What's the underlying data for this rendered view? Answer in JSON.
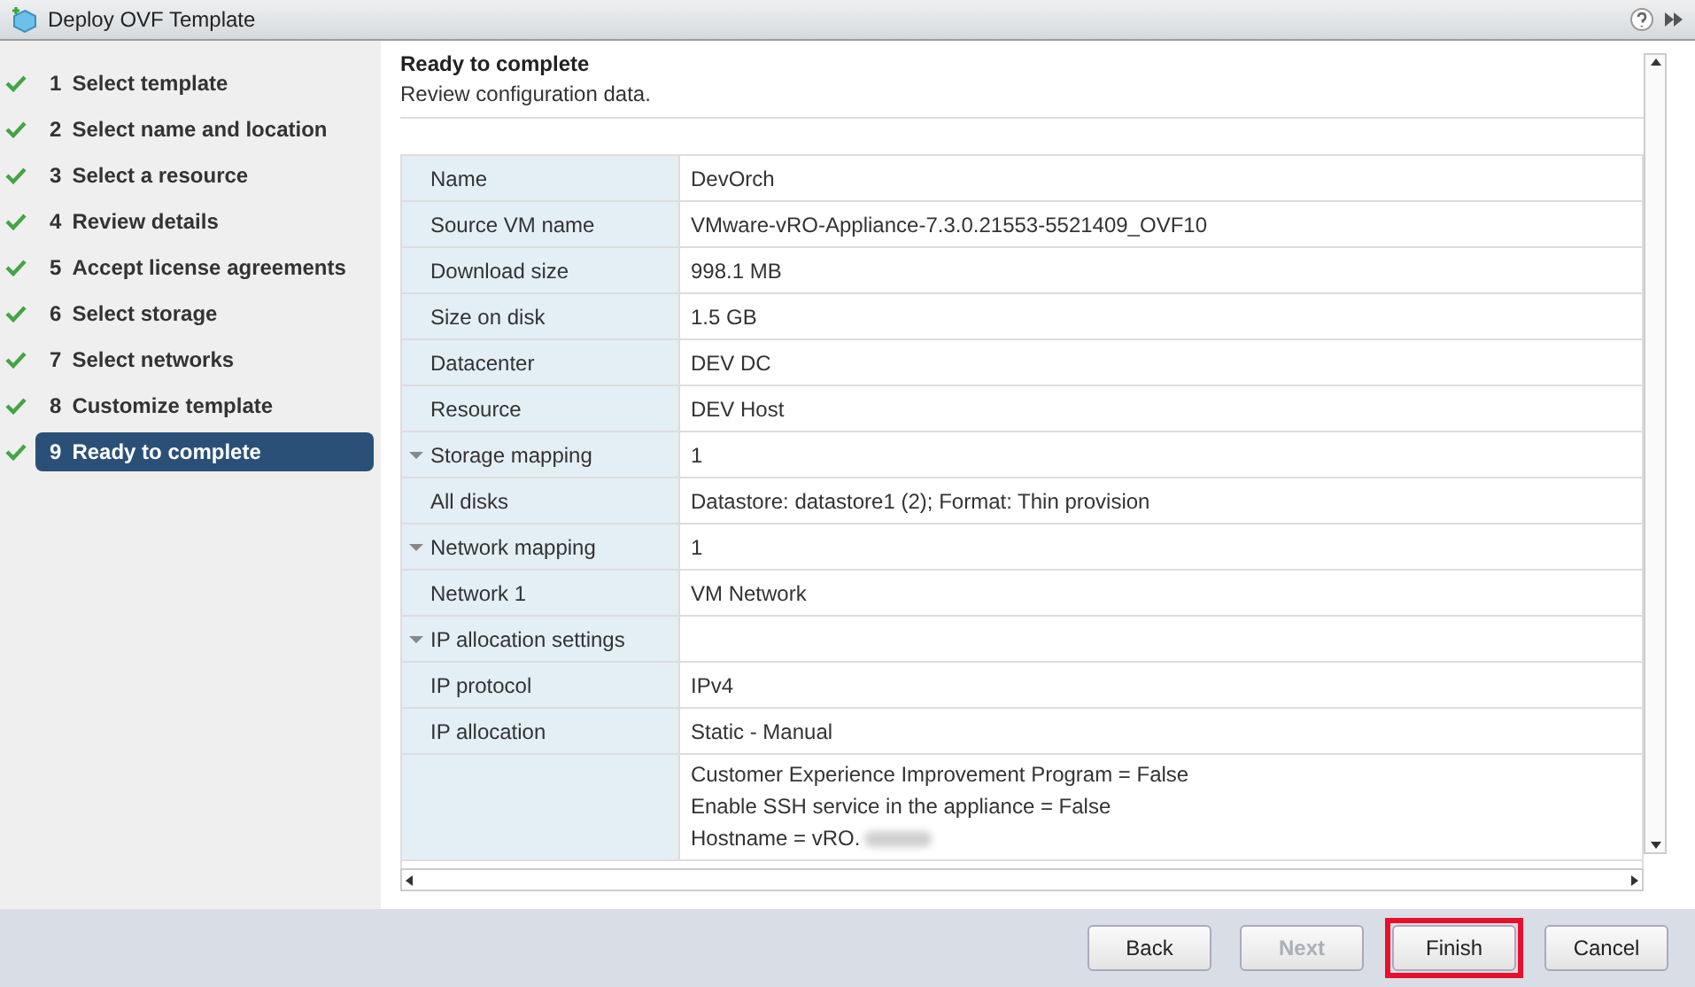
{
  "window": {
    "title": "Deploy OVF Template"
  },
  "steps": [
    {
      "number": "1",
      "label": "Select template",
      "done": true,
      "selected": false
    },
    {
      "number": "2",
      "label": "Select name and location",
      "done": true,
      "selected": false
    },
    {
      "number": "3",
      "label": "Select a resource",
      "done": true,
      "selected": false
    },
    {
      "number": "4",
      "label": "Review details",
      "done": true,
      "selected": false
    },
    {
      "number": "5",
      "label": "Accept license agreements",
      "done": true,
      "selected": false
    },
    {
      "number": "6",
      "label": "Select storage",
      "done": true,
      "selected": false
    },
    {
      "number": "7",
      "label": "Select networks",
      "done": true,
      "selected": false
    },
    {
      "number": "8",
      "label": "Customize template",
      "done": true,
      "selected": false
    },
    {
      "number": "9",
      "label": "Ready to complete",
      "done": true,
      "selected": true
    }
  ],
  "page": {
    "title": "Ready to complete",
    "subtitle": "Review configuration data."
  },
  "rows": [
    {
      "label": "Name",
      "value": "DevOrch"
    },
    {
      "label": "Source VM name",
      "value": "VMware-vRO-Appliance-7.3.0.21553-5521409_OVF10"
    },
    {
      "label": "Download size",
      "value": "998.1 MB"
    },
    {
      "label": "Size on disk",
      "value": "1.5 GB"
    },
    {
      "label": "Datacenter",
      "value": "DEV DC"
    },
    {
      "label": "Resource",
      "value": "DEV Host"
    },
    {
      "label": "Storage mapping",
      "value": "1",
      "expanded": true
    },
    {
      "label": "All disks",
      "value": "Datastore: datastore1 (2); Format: Thin provision"
    },
    {
      "label": "Network mapping",
      "value": "1",
      "expanded": true
    },
    {
      "label": "Network 1",
      "value": "VM Network"
    },
    {
      "label": "IP allocation settings",
      "expanded": true
    },
    {
      "label": "IP protocol",
      "value": "IPv4"
    },
    {
      "label": "IP allocation",
      "value": "Static - Manual"
    },
    {
      "lines": [
        "Customer Experience Improvement Program = False",
        "Enable SSH service in the appliance = False",
        "Hostname = vRO."
      ]
    }
  ],
  "buttons": [
    {
      "label": "Back",
      "disabled": false,
      "highlighted": false
    },
    {
      "label": "Next",
      "disabled": true,
      "highlighted": false
    },
    {
      "label": "Finish",
      "disabled": false,
      "highlighted": true
    },
    {
      "label": "Cancel",
      "disabled": false,
      "highlighted": false
    }
  ]
}
